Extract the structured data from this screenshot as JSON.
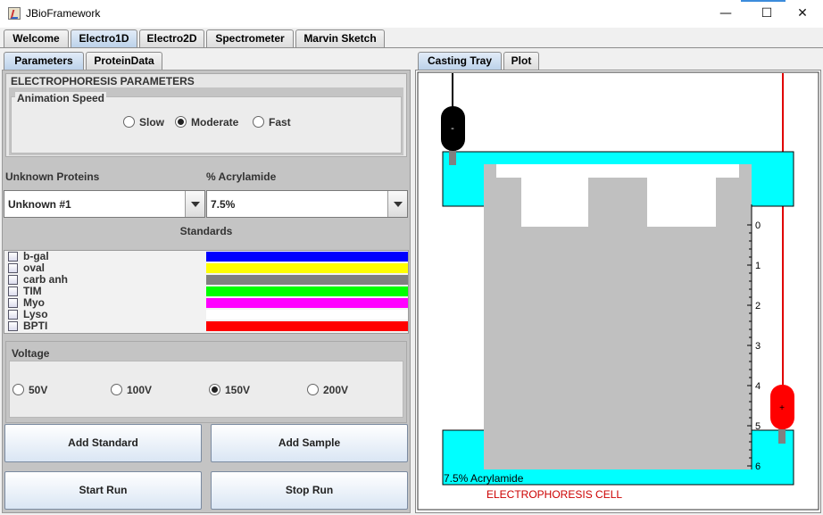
{
  "window": {
    "title": "JBioFramework"
  },
  "main_tabs": [
    {
      "label": "Welcome"
    },
    {
      "label": "Electro1D"
    },
    {
      "label": "Electro2D"
    },
    {
      "label": "Spectrometer"
    },
    {
      "label": "Marvin Sketch"
    }
  ],
  "left_tabs": [
    {
      "label": "Parameters"
    },
    {
      "label": "ProteinData"
    }
  ],
  "right_tabs": [
    {
      "label": "Casting Tray"
    },
    {
      "label": "Plot"
    }
  ],
  "params": {
    "header": "ELECTROPHORESIS PARAMETERS",
    "animation_speed": {
      "title": "Animation Speed",
      "options": [
        {
          "label": "Slow",
          "selected": false
        },
        {
          "label": "Moderate",
          "selected": true
        },
        {
          "label": "Fast",
          "selected": false
        }
      ]
    },
    "unknown_label": "Unknown Proteins",
    "acrylamide_label": "% Acrylamide",
    "unknown_value": "Unknown #1",
    "acrylamide_value": "7.5%",
    "standards_label": "Standards",
    "standards": [
      {
        "name": "b-gal",
        "color": "#0000ff"
      },
      {
        "name": "oval",
        "color": "#ffff00"
      },
      {
        "name": "carb anh",
        "color": "#808080"
      },
      {
        "name": "TIM",
        "color": "#00ff00"
      },
      {
        "name": "Myo",
        "color": "#ff00ff"
      },
      {
        "name": "Lyso",
        "color": "#ffffff"
      },
      {
        "name": "BPTI",
        "color": "#ff0000"
      }
    ],
    "voltage": {
      "title": "Voltage",
      "options": [
        {
          "label": "50V",
          "selected": false
        },
        {
          "label": "100V",
          "selected": false
        },
        {
          "label": "150V",
          "selected": true
        },
        {
          "label": "200V",
          "selected": false
        }
      ]
    },
    "buttons": {
      "add_standard": "Add Standard",
      "add_sample": "Add Sample",
      "start_run": "Start Run",
      "stop_run": "Stop Run"
    }
  },
  "casting_tray": {
    "negative_electrode": "-",
    "positive_electrode": "+",
    "ruler_ticks": [
      "0",
      "1",
      "2",
      "3",
      "4",
      "5",
      "6"
    ],
    "gel_label": "7.5% Acrylamide",
    "cell_label": "ELECTROPHORESIS CELL",
    "colors": {
      "buffer": "#00ffff",
      "gel": "#c0c0c0",
      "anode_wire": "#e00000",
      "label": "#cc0000"
    }
  }
}
